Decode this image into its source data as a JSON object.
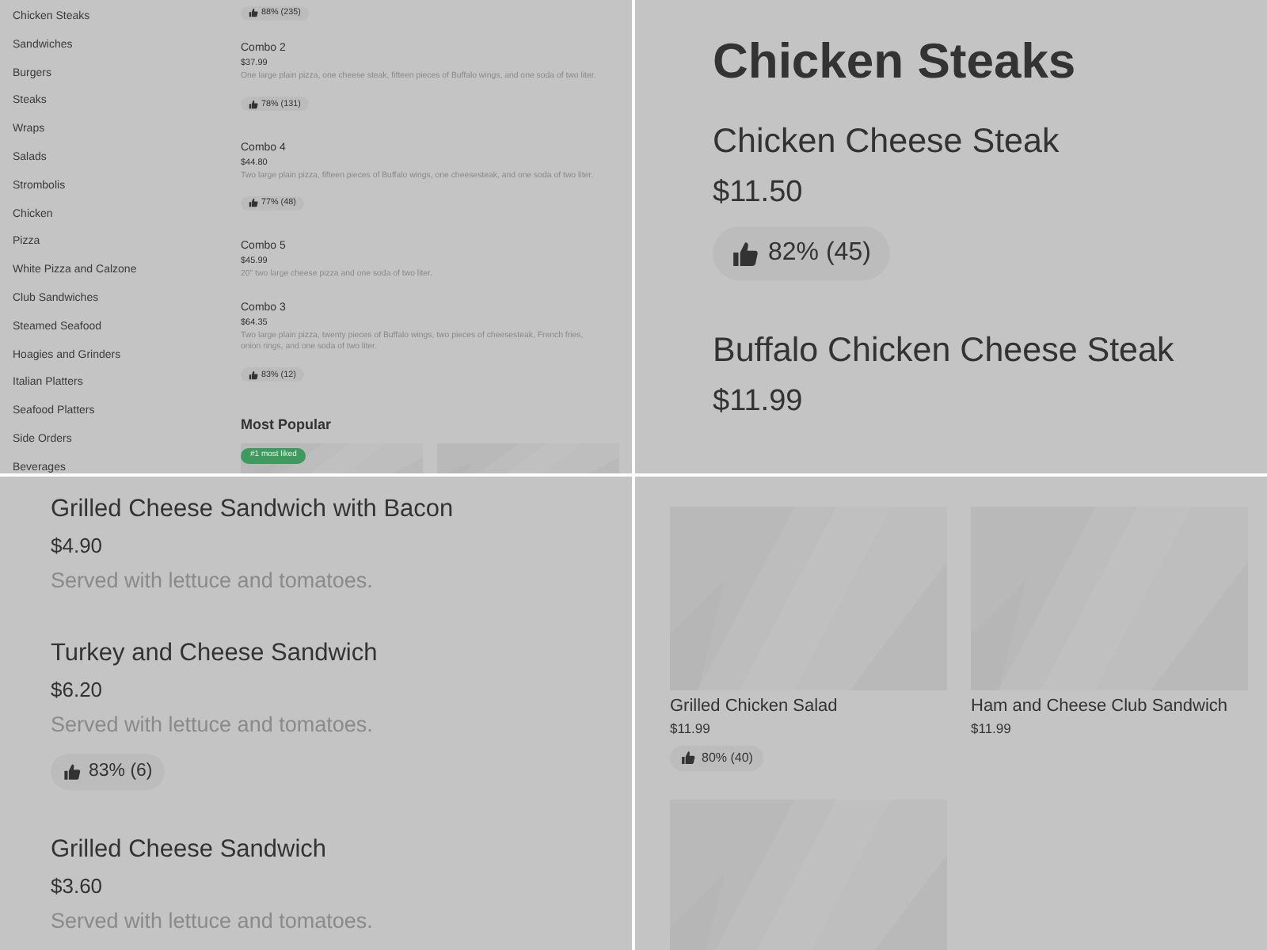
{
  "panels": [
    {
      "kind": "overview",
      "categories": [
        "Chicken Steaks",
        "Sandwiches",
        "Burgers",
        "Steaks",
        "Wraps",
        "Salads",
        "Strombolis",
        "Chicken",
        "Pizza",
        "White Pizza and Calzone",
        "Club Sandwiches",
        "Steamed Seafood",
        "Hoagies and Grinders",
        "Italian Platters",
        "Seafood Platters",
        "Side Orders",
        "Beverages"
      ],
      "items": [
        {
          "rating": "88% (235)"
        },
        {
          "name": "Combo 2",
          "price": "$37.99",
          "description": "One large plain pizza, one cheese steak, fifteen pieces of Buffalo wings, and one soda of two liter.",
          "rating": "78% (131)"
        },
        {
          "name": "Combo 4",
          "price": "$44.80",
          "description": "Two large plain pizza, fifteen pieces of Buffalo wings, one cheesesteak, and one soda of two liter.",
          "rating": "77% (48)"
        },
        {
          "name": "Combo 5",
          "price": "$45.99",
          "description": "20\" two large cheese pizza and one soda of two liter."
        },
        {
          "name": "Combo 3",
          "price": "$64.35",
          "description": "Two large plain pizza, twenty pieces of Buffalo wings, two pieces of cheesesteak, French fries, onion rings, and one soda of two liter.",
          "rating": "83% (12)"
        }
      ],
      "section": {
        "title": "Most Popular",
        "cards": [
          {
            "kind": "picture",
            "badge": "#1 most liked"
          },
          {
            "kind": "picture"
          }
        ]
      }
    },
    {
      "kind": "list",
      "heading": "Chicken Steaks",
      "items": [
        {
          "name": "Chicken Cheese Steak",
          "price": "$11.50",
          "rating": "82% (45)"
        },
        {
          "name": "Buffalo Chicken Cheese Steak",
          "price": "$11.99"
        }
      ]
    },
    {
      "kind": "list",
      "items": [
        {
          "name": "Grilled Cheese Sandwich with Bacon",
          "price": "$4.90",
          "description": "Served with lettuce and tomatoes."
        },
        {
          "name": "Turkey and Cheese Sandwich",
          "price": "$6.20",
          "description": "Served with lettuce and tomatoes.",
          "rating": "83% (6)"
        },
        {
          "name": "Grilled Cheese Sandwich",
          "price": "$3.60",
          "description": "Served with lettuce and tomatoes."
        }
      ]
    },
    {
      "kind": "cards",
      "cards": [
        {
          "kind": "picture",
          "name": "Grilled Chicken Salad",
          "price": "$11.99",
          "rating": "80% (40)"
        },
        {
          "kind": "picture",
          "name": "Ham and Cheese Club Sandwich",
          "price": "$11.99"
        },
        {
          "kind": "picture"
        }
      ]
    }
  ]
}
